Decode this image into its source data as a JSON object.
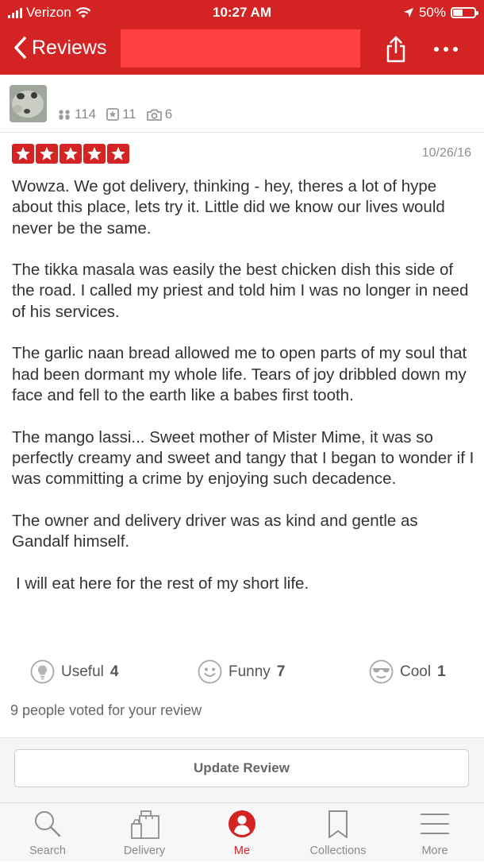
{
  "status_bar": {
    "carrier": "Verizon",
    "time": "10:27 AM",
    "battery_text": "50%",
    "battery_level": 0.5
  },
  "nav": {
    "back_label": "Reviews",
    "title": ""
  },
  "user": {
    "friends": "114",
    "reviews": "11",
    "photos": "6"
  },
  "review": {
    "rating": 5,
    "date": "10/26/16",
    "paragraphs": [
      "Wowza. We got delivery, thinking - hey, theres a lot of hype about this place, lets try it. Little did we know our lives would never be the same.",
      "The tikka masala was easily the best chicken dish this side of the road. I called my priest and told him I was no longer in need of his services.",
      "The garlic naan bread allowed me to open parts of my soul that had been dormant my whole life. Tears of joy dribbled down my face and fell to the earth like a babes first tooth.",
      "The mango lassi... Sweet mother of Mister Mime, it was so perfectly creamy and sweet and tangy that I began to wonder if I was committing a crime by enjoying such decadence.",
      "The owner and delivery driver was as kind and gentle as Gandalf himself.",
      "I will eat here for the rest of my short life."
    ]
  },
  "votes": {
    "useful_label": "Useful",
    "useful_count": "4",
    "funny_label": "Funny",
    "funny_count": "7",
    "cool_label": "Cool",
    "cool_count": "1",
    "summary": "9 people voted for your review"
  },
  "actions": {
    "update_review": "Update Review"
  },
  "tabs": [
    {
      "label": "Search",
      "icon": "search-icon"
    },
    {
      "label": "Delivery",
      "icon": "delivery-bag-icon"
    },
    {
      "label": "Me",
      "icon": "profile-icon"
    },
    {
      "label": "Collections",
      "icon": "bookmark-icon"
    },
    {
      "label": "More",
      "icon": "menu-icon"
    }
  ],
  "colors": {
    "brand_red": "#d32323",
    "redaction_box": "#ff4040"
  }
}
